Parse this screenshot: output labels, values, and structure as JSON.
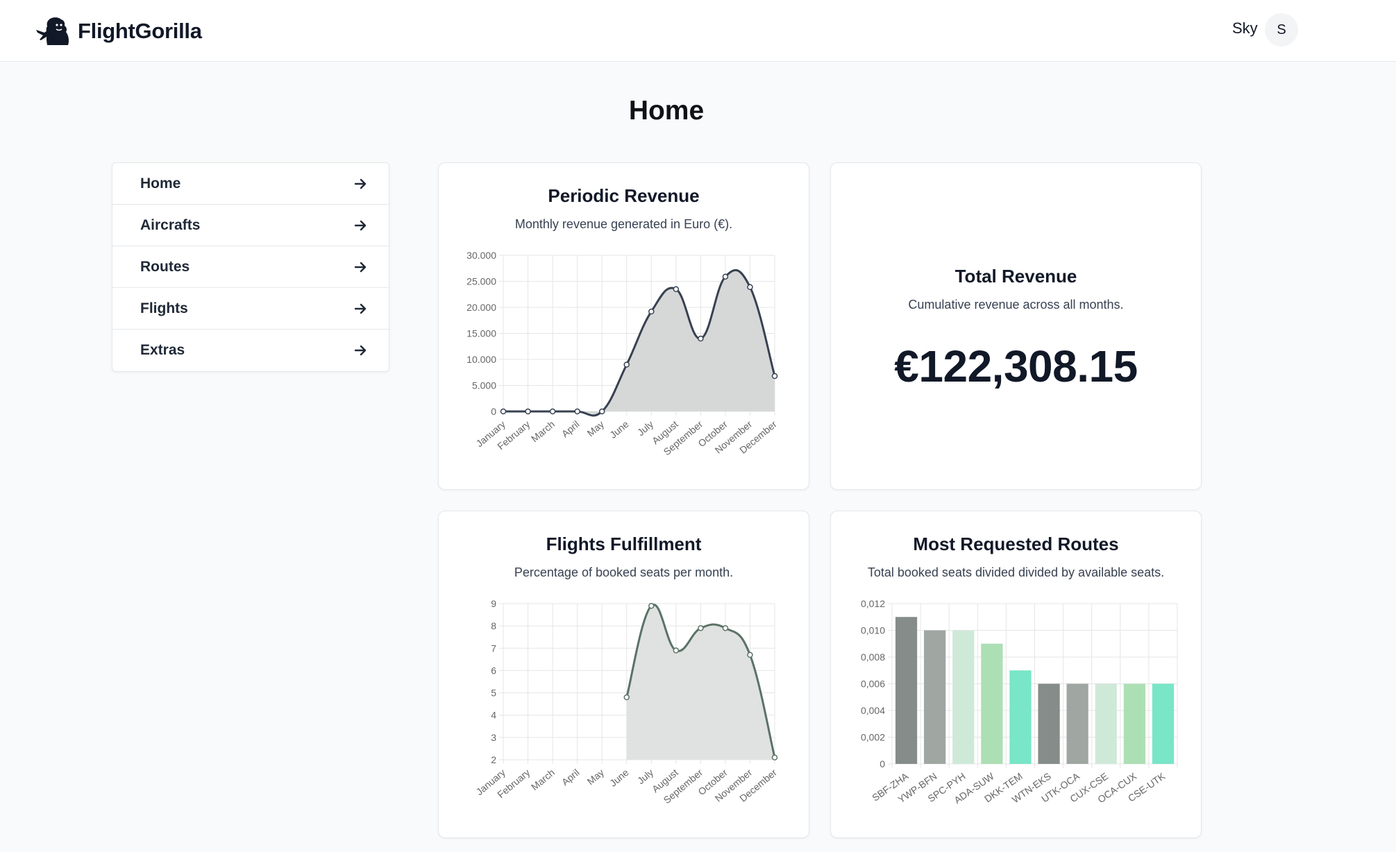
{
  "header": {
    "brand": "FlightGorilla",
    "user_name": "Sky",
    "avatar_initial": "S"
  },
  "page": {
    "title": "Home"
  },
  "nav": {
    "items": [
      {
        "label": "Home"
      },
      {
        "label": "Aircrafts"
      },
      {
        "label": "Routes"
      },
      {
        "label": "Flights"
      },
      {
        "label": "Extras"
      }
    ]
  },
  "cards": {
    "revenue": {
      "title": "Periodic Revenue",
      "subtitle": "Monthly revenue generated in Euro (€)."
    },
    "total": {
      "title": "Total Revenue",
      "subtitle": "Cumulative revenue across all months.",
      "value": "€122,308.15"
    },
    "fulfillment": {
      "title": "Flights Fulfillment",
      "subtitle": "Percentage of booked seats per month."
    },
    "routes": {
      "title": "Most Requested Routes",
      "subtitle": "Total booked seats divided divided by available seats."
    }
  },
  "chart_data": [
    {
      "id": "revenue",
      "type": "area",
      "title": "Periodic Revenue",
      "categories": [
        "January",
        "February",
        "March",
        "April",
        "May",
        "June",
        "July",
        "August",
        "September",
        "October",
        "November",
        "December"
      ],
      "values": [
        0,
        0,
        0,
        0,
        0,
        9000,
        19200,
        23500,
        14000,
        25900,
        23900,
        6800
      ],
      "ylim": [
        0,
        30000
      ],
      "yticks": [
        "0",
        "5.000",
        "10.000",
        "15.000",
        "20.000",
        "25.000",
        "30.000"
      ],
      "grid": true,
      "line_color": "#374151",
      "fill_color": "#d4d6d5"
    },
    {
      "id": "fulfillment",
      "type": "area",
      "title": "Flights Fulfillment",
      "categories": [
        "January",
        "February",
        "March",
        "April",
        "May",
        "June",
        "July",
        "August",
        "September",
        "October",
        "November",
        "December"
      ],
      "values": [
        null,
        null,
        null,
        null,
        null,
        4.8,
        8.9,
        6.9,
        7.9,
        7.9,
        6.7,
        2.1
      ],
      "ylim": [
        2,
        9
      ],
      "yticks": [
        "2",
        "3",
        "4",
        "5",
        "6",
        "7",
        "8",
        "9"
      ],
      "grid": true,
      "line_color": "#5b7266",
      "fill_color": "#dde0de"
    },
    {
      "id": "routes",
      "type": "bar",
      "title": "Most Requested Routes",
      "categories": [
        "SBF-ZHA",
        "YWP-BFN",
        "SPC-PYH",
        "ADA-SUW",
        "DKK-TEM",
        "WTN-EKS",
        "UTK-OCA",
        "CUX-CSE",
        "OCA-CUX",
        "CSE-UTK"
      ],
      "values": [
        0.011,
        0.01,
        0.01,
        0.009,
        0.007,
        0.006,
        0.006,
        0.006,
        0.006,
        0.006
      ],
      "ylim": [
        0,
        0.012
      ],
      "yticks": [
        "0",
        "0,002",
        "0,004",
        "0,006",
        "0,008",
        "0,010",
        "0,012"
      ],
      "grid": true,
      "colors": [
        "#858c89",
        "#a0a6a1",
        "#cfe9d9",
        "#addfb5",
        "#78e6c7",
        "#858c89",
        "#a0a6a1",
        "#cfe9d9",
        "#addfb5",
        "#78e6c7"
      ]
    }
  ]
}
